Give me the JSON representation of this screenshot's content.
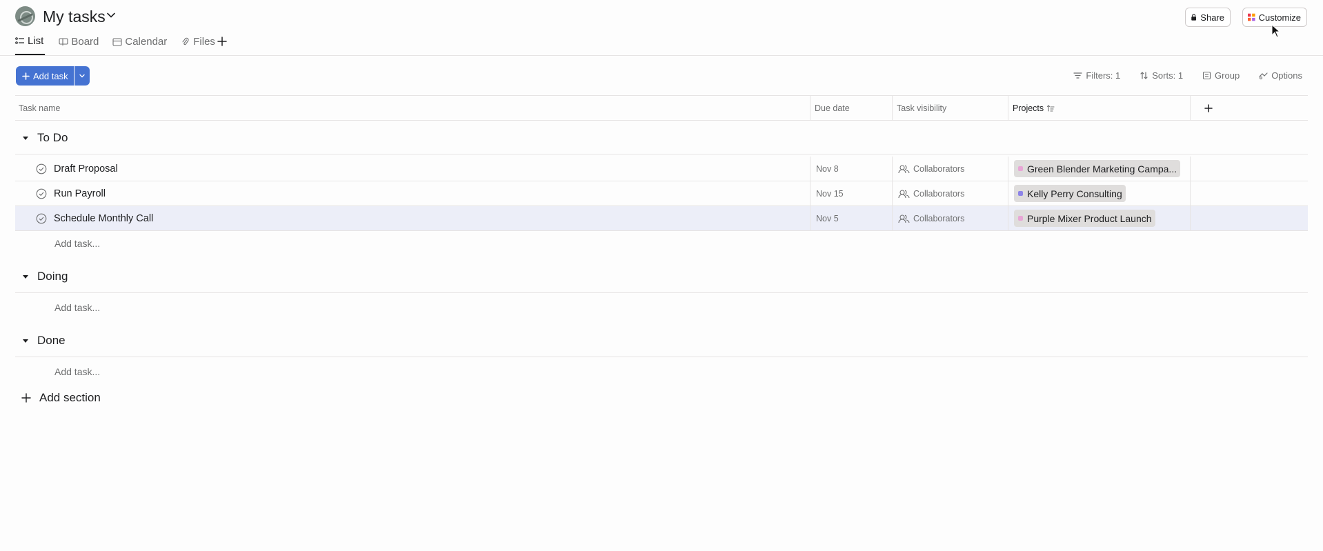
{
  "header": {
    "title": "My tasks",
    "share_label": "Share",
    "customize_label": "Customize"
  },
  "tabs": [
    {
      "label": "List",
      "icon": "list-icon",
      "active": true
    },
    {
      "label": "Board",
      "icon": "board-icon",
      "active": false
    },
    {
      "label": "Calendar",
      "icon": "calendar-icon",
      "active": false
    },
    {
      "label": "Files",
      "icon": "paperclip-icon",
      "active": false
    }
  ],
  "toolbar": {
    "add_task_label": "Add task",
    "filters_label": "Filters: 1",
    "sorts_label": "Sorts: 1",
    "group_label": "Group",
    "options_label": "Options"
  },
  "columns": {
    "name": "Task name",
    "due": "Due date",
    "visibility": "Task visibility",
    "projects": "Projects"
  },
  "sections": [
    {
      "title": "To Do",
      "add_task": "Add task...",
      "tasks": [
        {
          "name": "Draft Proposal",
          "due": "Nov 8",
          "visibility": "Collaborators",
          "project": "Green Blender Marketing Campa...",
          "project_color": "#e8a6d6"
        },
        {
          "name": "Run Payroll",
          "due": "Nov 15",
          "visibility": "Collaborators",
          "project": "Kelly Perry Consulting",
          "project_color": "#8d84e8"
        },
        {
          "name": "Schedule Monthly Call",
          "due": "Nov 5",
          "visibility": "Collaborators",
          "project": "Purple Mixer Product Launch",
          "project_color": "#e8a6d6"
        }
      ]
    },
    {
      "title": "Doing",
      "add_task": "Add task...",
      "tasks": []
    },
    {
      "title": "Done",
      "add_task": "Add task...",
      "tasks": []
    }
  ],
  "add_section_label": "Add section",
  "colors": {
    "accent": "#4573d2",
    "selected_row": "#eceef8"
  }
}
